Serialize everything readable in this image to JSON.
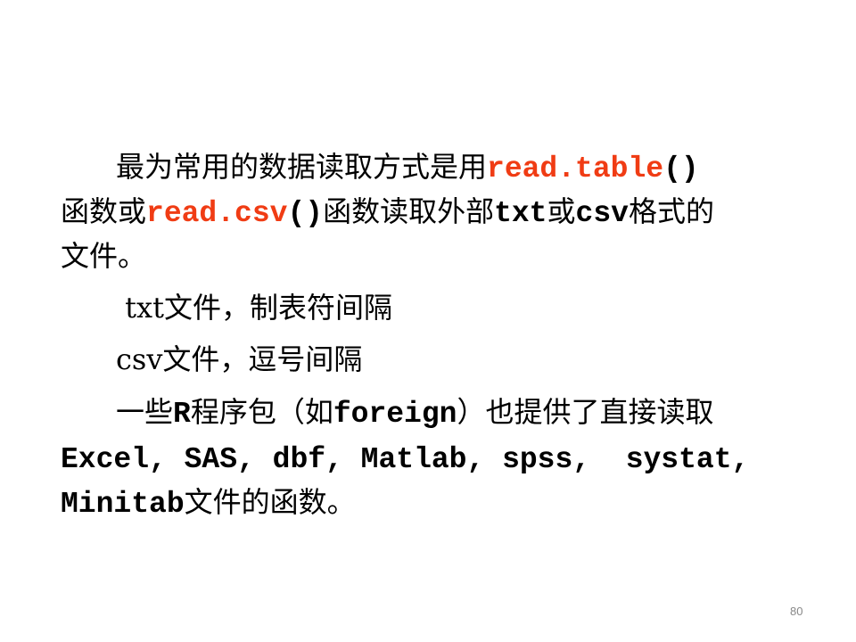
{
  "slide": {
    "accent_color": "#f03c14",
    "page_number": "80",
    "lines": [
      {
        "indent": true,
        "segments": [
          {
            "text": "最为常用的数据读取方式是用",
            "style": "plain"
          },
          {
            "text": "read.table",
            "style": "code-red"
          },
          {
            "text": "()",
            "style": "code"
          }
        ]
      },
      {
        "indent": false,
        "segments": [
          {
            "text": "函数或",
            "style": "plain"
          },
          {
            "text": "read.csv",
            "style": "code-red"
          },
          {
            "text": "()",
            "style": "code"
          },
          {
            "text": "函数读取外部",
            "style": "plain"
          },
          {
            "text": "txt",
            "style": "code"
          },
          {
            "text": "或",
            "style": "plain"
          },
          {
            "text": "csv",
            "style": "code"
          },
          {
            "text": "格式的",
            "style": "plain"
          }
        ]
      },
      {
        "indent": false,
        "segments": [
          {
            "text": "文件。",
            "style": "plain"
          }
        ]
      },
      {
        "indent": true,
        "segments": [
          {
            "text": " txt文件，制表符间隔",
            "style": "plain"
          }
        ]
      },
      {
        "indent": true,
        "segments": [
          {
            "text": "csv文件，逗号间隔",
            "style": "plain"
          }
        ]
      },
      {
        "indent": true,
        "segments": [
          {
            "text": "一些",
            "style": "plain"
          },
          {
            "text": "R",
            "style": "code"
          },
          {
            "text": "程序包（如",
            "style": "plain"
          },
          {
            "text": "foreign",
            "style": "code"
          },
          {
            "text": "）也提供了直接读取",
            "style": "plain"
          }
        ]
      },
      {
        "indent": false,
        "segments": [
          {
            "text": "Excel, SAS, dbf, Matlab, spss,  systat,",
            "style": "code"
          }
        ]
      },
      {
        "indent": false,
        "segments": [
          {
            "text": "Minitab",
            "style": "code"
          },
          {
            "text": "文件的函数。",
            "style": "plain"
          }
        ]
      }
    ]
  }
}
